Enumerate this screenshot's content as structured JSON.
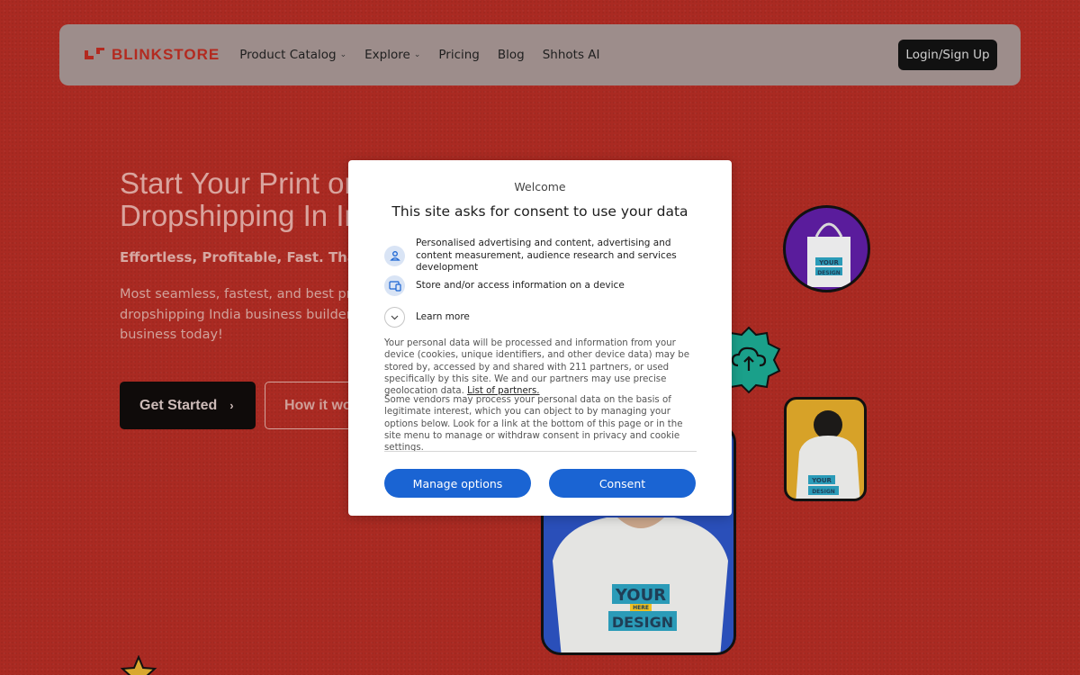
{
  "header": {
    "logo_text": "BLINKSTORE",
    "nav": [
      {
        "label": "Product Catalog",
        "dropdown": true
      },
      {
        "label": "Explore",
        "dropdown": true
      },
      {
        "label": "Pricing",
        "dropdown": false
      },
      {
        "label": "Blog",
        "dropdown": false
      },
      {
        "label": "Shhots AI",
        "dropdown": false
      }
    ],
    "login_label": "Login/Sign Up"
  },
  "hero": {
    "title_line1": "Start Your Print on",
    "title_line2": "Dropshipping In In",
    "subtitle": "Effortless, Profitable, Fast. That's y",
    "description_line1": "Most seamless, fastest, and best pri",
    "description_line2": "dropshipping India business builder",
    "description_line3": "business today!",
    "get_started_label": "Get Started",
    "how_it_works_label": "How it wo"
  },
  "mockups": {
    "print_text_1": "YOUR",
    "print_text_2": "DESIGN",
    "print_text_here": "HERE"
  },
  "consent": {
    "welcome": "Welcome",
    "title": "This site asks for consent to use your data",
    "purposes": [
      {
        "icon": "person-icon",
        "text": "Personalised advertising and content, advertising and content measurement, audience research and services development"
      },
      {
        "icon": "device-icon",
        "text": "Store and/or access information on a device"
      }
    ],
    "learn_more": "Learn more",
    "paragraph1": "Your personal data will be processed and information from your device (cookies, unique identifiers, and other device data) may be stored by, accessed by and shared with 211 partners, or used specifically by this site. We and our partners may use precise geolocation data.",
    "partners_link": "List of partners.",
    "paragraph2": "Some vendors may process your personal data on the basis of legitimate interest, which you can object to by managing your options below. Look for a link at the bottom of this page or in the site menu to manage or withdraw consent in privacy and cookie settings.",
    "manage_label": "Manage options",
    "consent_label": "Consent",
    "accent_color": "#1a64d3"
  },
  "colors": {
    "page_background": "#aa2a22",
    "brand_red": "#b32a20",
    "header_overlay": "#9d8d8b"
  }
}
